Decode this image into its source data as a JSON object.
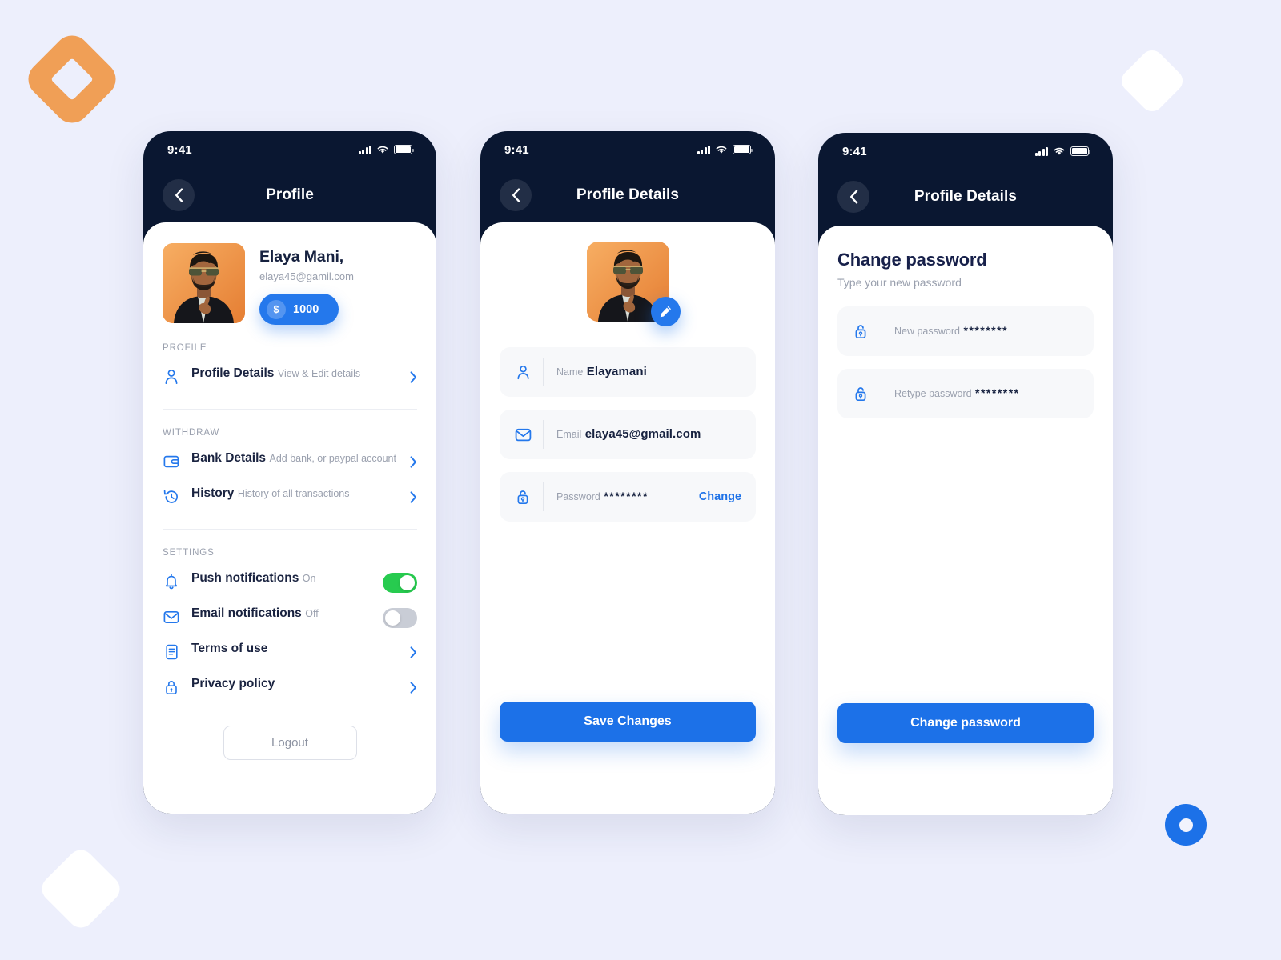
{
  "brand": {
    "logo_icon": "diamond-logo-icon",
    "accent_orange": "#F09F56",
    "accent_blue": "#1C71E8",
    "toggle_on_green": "#27CB4F",
    "page_background": "#EDEFFC",
    "header_navy": "#0A1731"
  },
  "decorations": {
    "diamond_top_right_icon": "diamond-shape-icon",
    "diamond_bottom_left_icon": "diamond-shape-icon",
    "ring_bottom_right_icon": "ring-shape-icon"
  },
  "statusbar": {
    "time": "9:41",
    "signal_icon": "cellular-signal-icon",
    "wifi_icon": "wifi-icon",
    "battery_icon": "battery-full-icon"
  },
  "screen1": {
    "nav": {
      "back_icon": "chevron-left-icon",
      "title": "Profile"
    },
    "user": {
      "avatar_icon": "user-avatar-photo",
      "name": "Elaya Mani,",
      "email": "elaya45@gamil.com",
      "currency_symbol": "$",
      "balance": "1000"
    },
    "sections": [
      {
        "label": "PROFILE",
        "items": [
          {
            "icon": "user-icon",
            "title": "Profile Details",
            "subtitle": "View & Edit details",
            "control": "chevron"
          }
        ]
      },
      {
        "label": "WITHDRAW",
        "items": [
          {
            "icon": "wallet-icon",
            "title": "Bank Details",
            "subtitle": "Add bank, or paypal account",
            "control": "chevron"
          },
          {
            "icon": "history-icon",
            "title": "History",
            "subtitle": "History of all transactions",
            "control": "chevron"
          }
        ]
      },
      {
        "label": "SETTINGS",
        "items": [
          {
            "icon": "bell-icon",
            "title": "Push notifications",
            "subtitle": "On",
            "control": "toggle",
            "toggle_state": "on"
          },
          {
            "icon": "mail-icon",
            "title": "Email notifications",
            "subtitle": "Off",
            "control": "toggle",
            "toggle_state": "off"
          },
          {
            "icon": "document-icon",
            "title": "Terms of use",
            "subtitle": "",
            "control": "chevron"
          },
          {
            "icon": "lock-icon",
            "title": "Privacy policy",
            "subtitle": "",
            "control": "chevron"
          }
        ]
      }
    ],
    "logout_label": "Logout"
  },
  "screen2": {
    "nav": {
      "back_icon": "chevron-left-icon",
      "title": "Profile Details"
    },
    "avatar_icon": "user-avatar-photo",
    "edit_icon": "pencil-edit-icon",
    "fields": [
      {
        "icon": "user-icon",
        "label": "Name",
        "value": "Elayamani",
        "action": ""
      },
      {
        "icon": "mail-icon",
        "label": "Email",
        "value": "elaya45@gmail.com",
        "action": ""
      },
      {
        "icon": "lock-icon",
        "label": "Password",
        "value": "********",
        "action": "Change"
      }
    ],
    "submit_label": "Save Changes"
  },
  "screen3": {
    "nav": {
      "back_icon": "chevron-left-icon",
      "title": "Profile Details"
    },
    "title": "Change password",
    "subtitle": "Type your new password",
    "fields": [
      {
        "icon": "lock-icon",
        "label": "New password",
        "value": "********"
      },
      {
        "icon": "lock-icon",
        "label": "Retype password",
        "value": "********"
      }
    ],
    "submit_label": "Change password"
  }
}
